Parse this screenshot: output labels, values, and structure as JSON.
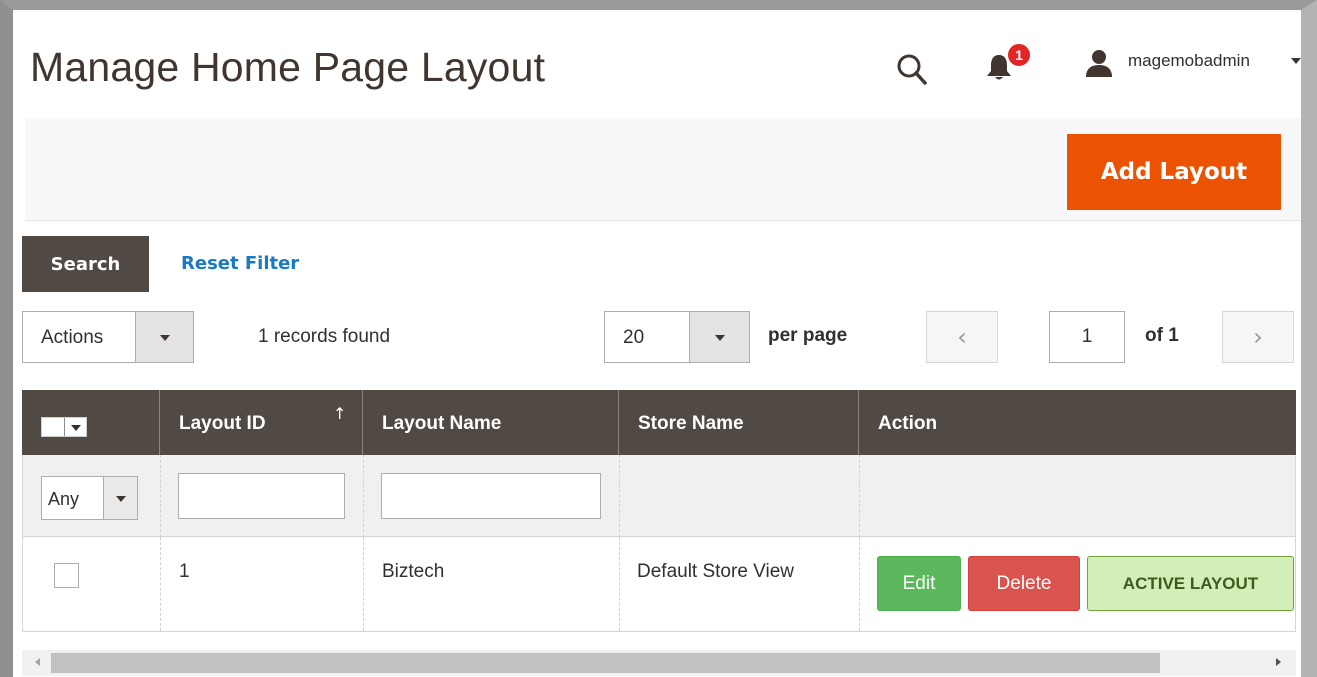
{
  "header": {
    "title": "Manage Home Page Layout",
    "notification_count": "1",
    "username": "magemobadmin"
  },
  "page_actions": {
    "add_layout_label": "Add Layout"
  },
  "filters": {
    "search_label": "Search",
    "reset_label": "Reset Filter"
  },
  "toolbar": {
    "actions_label": "Actions",
    "records_found": "1 records found",
    "page_size": "20",
    "per_page_label": "per page",
    "prev_icon": "‹",
    "current_page": "1",
    "page_of": "of 1",
    "next_icon": "›"
  },
  "grid": {
    "columns": [
      {
        "label": ""
      },
      {
        "label": "Layout ID"
      },
      {
        "label": "Layout Name"
      },
      {
        "label": "Store Name"
      },
      {
        "label": "Action"
      }
    ],
    "sort_icon": "↑",
    "filter_any": "Any",
    "rows": [
      {
        "layout_id": "1",
        "layout_name": "Biztech",
        "store_name": "Default Store View",
        "actions": {
          "edit": "Edit",
          "delete": "Delete",
          "active": "ACTIVE LAYOUT"
        }
      }
    ]
  },
  "colors": {
    "accent_orange": "#eb5202",
    "header_dark": "#514943",
    "link_blue": "#1979c3",
    "edit_green": "#5cb85c",
    "delete_red": "#d9534f",
    "active_green_bg": "#d3eeb6",
    "badge_red": "#e22626"
  }
}
